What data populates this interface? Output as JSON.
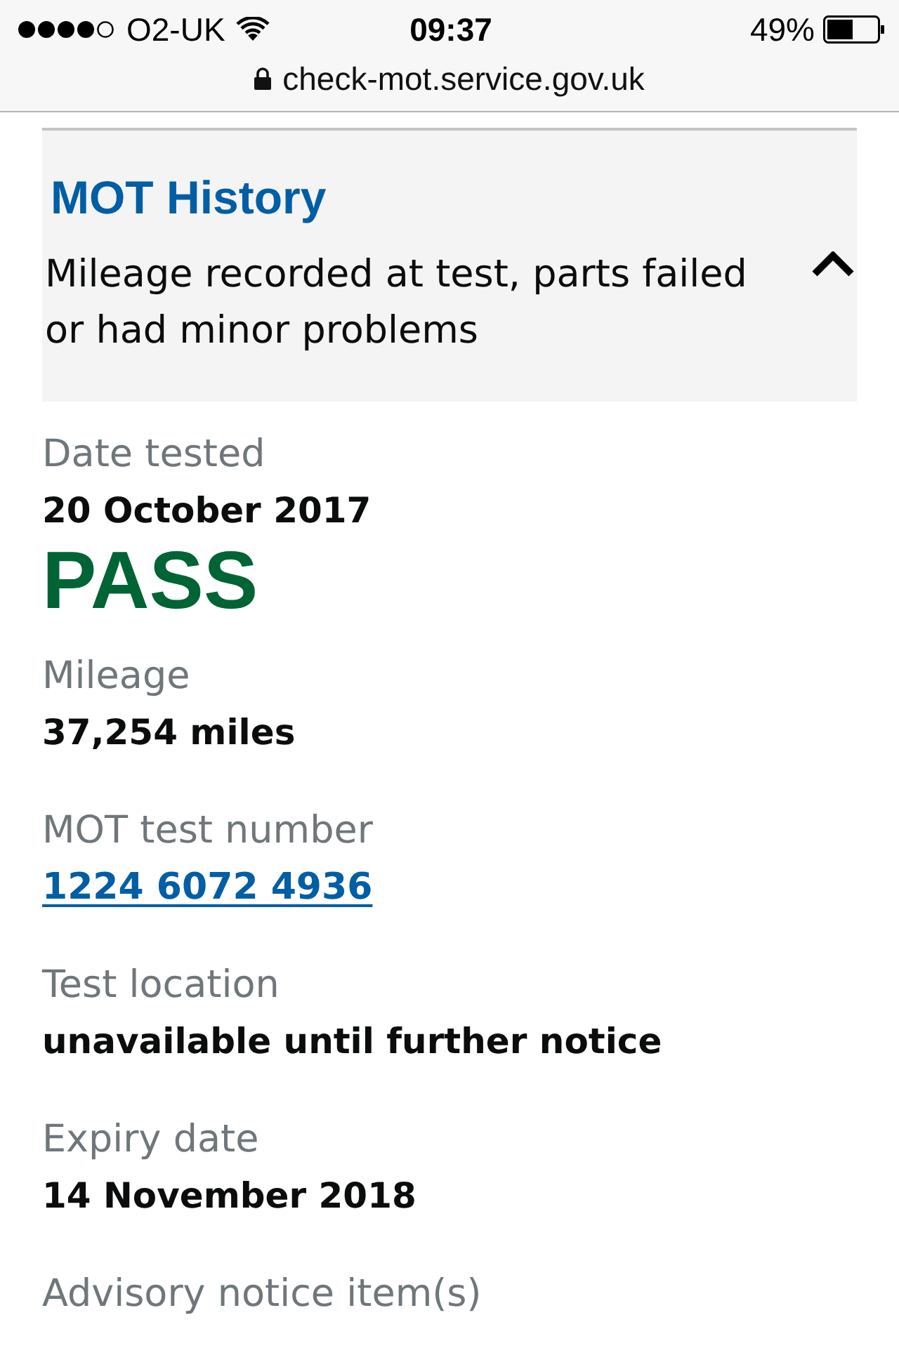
{
  "status_bar": {
    "carrier": "O2-UK",
    "time": "09:37",
    "battery": "49%"
  },
  "address_bar": {
    "url": "check-mot.service.gov.uk"
  },
  "history_panel": {
    "title": "MOT History",
    "description": "Mileage recorded at test, parts failed or had minor problems",
    "expanded": true
  },
  "test_date": {
    "label": "Date tested",
    "value": "20 October 2017"
  },
  "result": {
    "text": "PASS",
    "kind": "pass"
  },
  "fields": [
    {
      "label": "Mileage",
      "value": "37,254 miles",
      "kind": "text"
    },
    {
      "label": "MOT test number",
      "value": "1224 6072 4936",
      "kind": "link"
    },
    {
      "label": "Test location",
      "value": "unavailable until further notice",
      "kind": "text"
    },
    {
      "label": "Expiry date",
      "value": "14 November 2018",
      "kind": "text"
    },
    {
      "label": "Advisory notice item(s)",
      "kind": "heading"
    }
  ]
}
